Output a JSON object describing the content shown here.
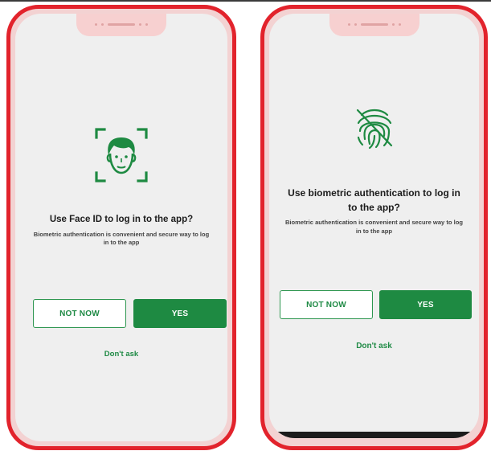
{
  "colors": {
    "accent": "#1e8a42",
    "frame": "#e2232c",
    "screen": "#efefef"
  },
  "screens": [
    {
      "icon": "face-id-icon",
      "title": "Use Face ID to log in to the app?",
      "description": "Biometric authentication is convenient and secure way to log in to the app",
      "secondary_label": "NOT NOW",
      "primary_label": "YES",
      "link_label": "Don't ask"
    },
    {
      "icon": "fingerprint-off-icon",
      "title": "Use biometric authentication to log in to the app?",
      "description": "Biometric authentication is convenient and secure way to log in to the app",
      "secondary_label": "NOT NOW",
      "primary_label": "YES",
      "link_label": "Don't ask"
    }
  ]
}
